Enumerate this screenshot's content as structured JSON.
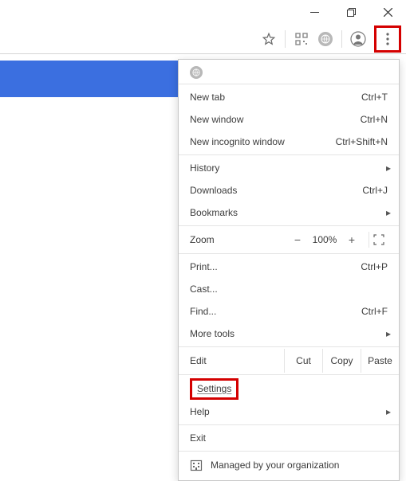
{
  "window": {
    "minimize": "—",
    "maximize": "❐",
    "close": "✕"
  },
  "toolbar": {
    "star": "☆",
    "qr": "QR",
    "profile": "●",
    "more": "⋮"
  },
  "menu": {
    "new_tab": {
      "label": "New tab",
      "shortcut": "Ctrl+T"
    },
    "new_window": {
      "label": "New window",
      "shortcut": "Ctrl+N"
    },
    "new_incognito": {
      "label": "New incognito window",
      "shortcut": "Ctrl+Shift+N"
    },
    "history": {
      "label": "History"
    },
    "downloads": {
      "label": "Downloads",
      "shortcut": "Ctrl+J"
    },
    "bookmarks": {
      "label": "Bookmarks"
    },
    "zoom": {
      "label": "Zoom",
      "minus": "−",
      "value": "100%",
      "plus": "+"
    },
    "print": {
      "label": "Print...",
      "shortcut": "Ctrl+P"
    },
    "cast": {
      "label": "Cast..."
    },
    "find": {
      "label": "Find...",
      "shortcut": "Ctrl+F"
    },
    "more_tools": {
      "label": "More tools"
    },
    "edit": {
      "label": "Edit",
      "cut": "Cut",
      "copy": "Copy",
      "paste": "Paste"
    },
    "settings": {
      "label": "Settings"
    },
    "help": {
      "label": "Help"
    },
    "exit": {
      "label": "Exit"
    },
    "managed": {
      "label": "Managed by your organization"
    }
  }
}
